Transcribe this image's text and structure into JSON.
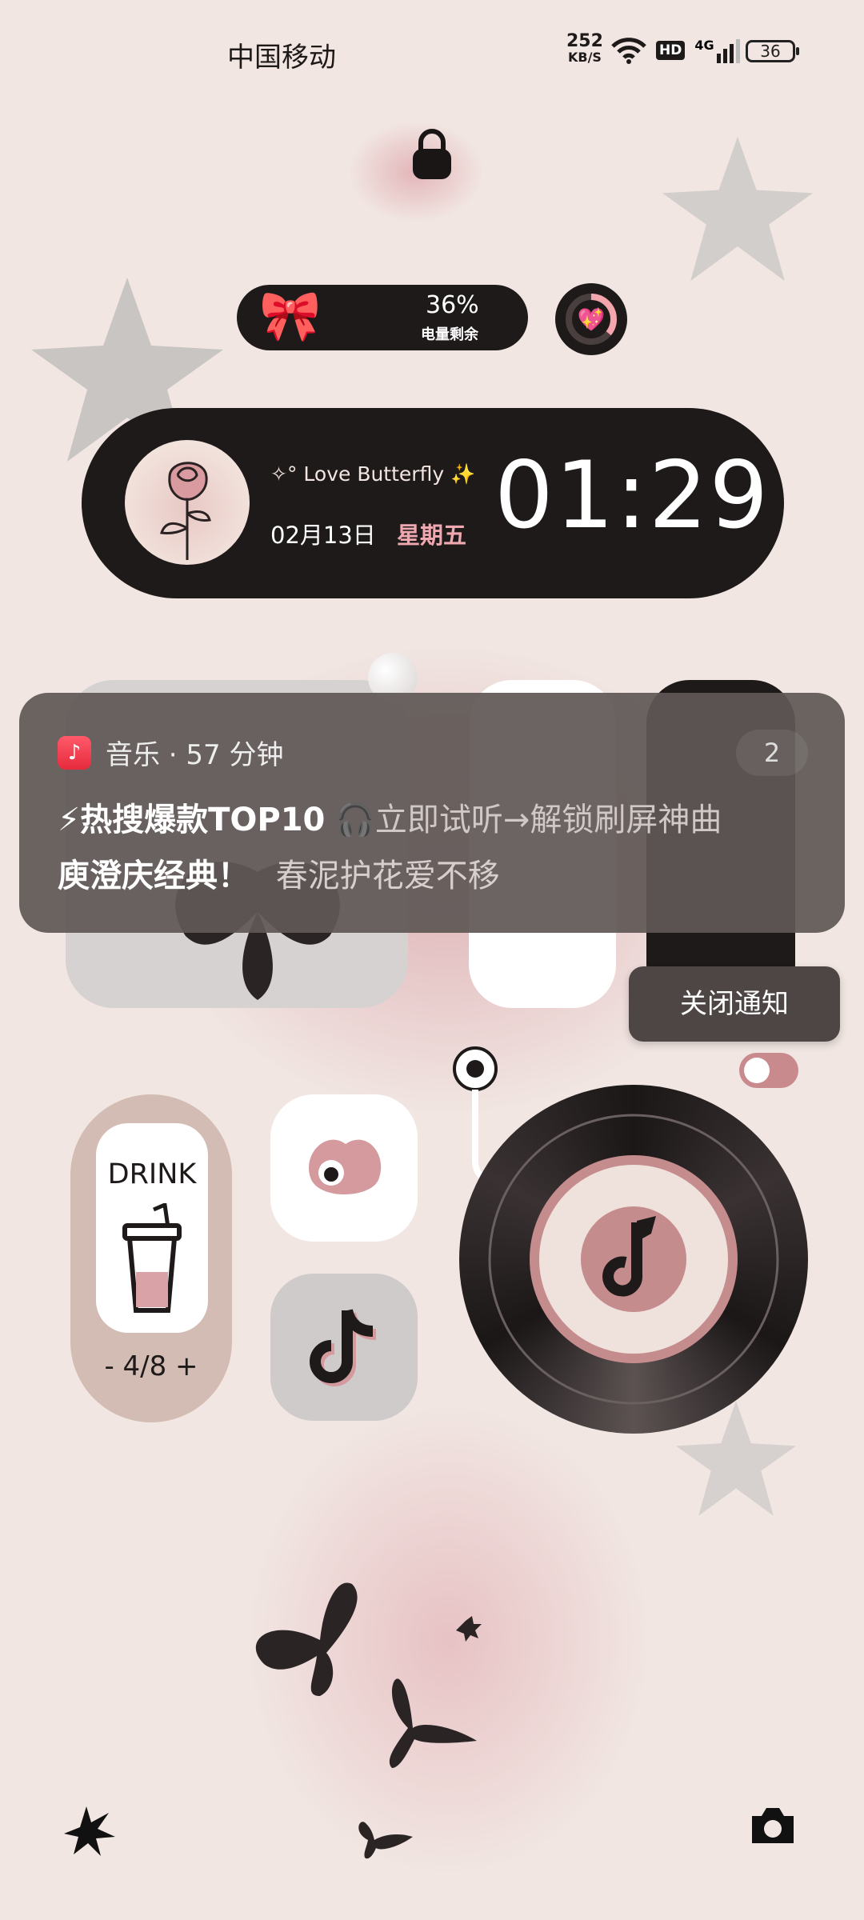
{
  "status_bar": {
    "carrier": "中国移动",
    "net_speed_value": "252",
    "net_speed_unit": "KB/S",
    "hd_badge": "HD",
    "network": "4G",
    "battery": "36"
  },
  "battery_widget": {
    "percent": "36%",
    "label": "电量剩余"
  },
  "clock_widget": {
    "title": "Love Butterfly",
    "date": "02月13日",
    "weekday": "星期五",
    "time": "01:29"
  },
  "notification": {
    "app": "音乐 · 57 分钟",
    "count": "2",
    "title_bold": "⚡热搜爆款TOP10",
    "title_rest": "🎧立即试听→解锁刷屏神曲",
    "body_bold": "庾澄庆经典！",
    "body_rest": "春泥护花爱不移",
    "close_label": "关闭通知"
  },
  "drink_widget": {
    "label": "DRINK",
    "counter": "- 4/8 +",
    "progress_fraction": 0.5
  },
  "colors": {
    "background": "#f1e6e2",
    "widget_dark": "#1f1a1a",
    "accent_pink": "#f0a8b0",
    "notification_bg": "#605856"
  },
  "icons": [
    "lock-icon",
    "bow-icon",
    "heart-ring-icon",
    "rose-icon",
    "music-app-icon",
    "shell-app-icon",
    "tiktok-app-icon",
    "vinyl-record-icon",
    "shortcut-star-icon",
    "camera-icon"
  ]
}
